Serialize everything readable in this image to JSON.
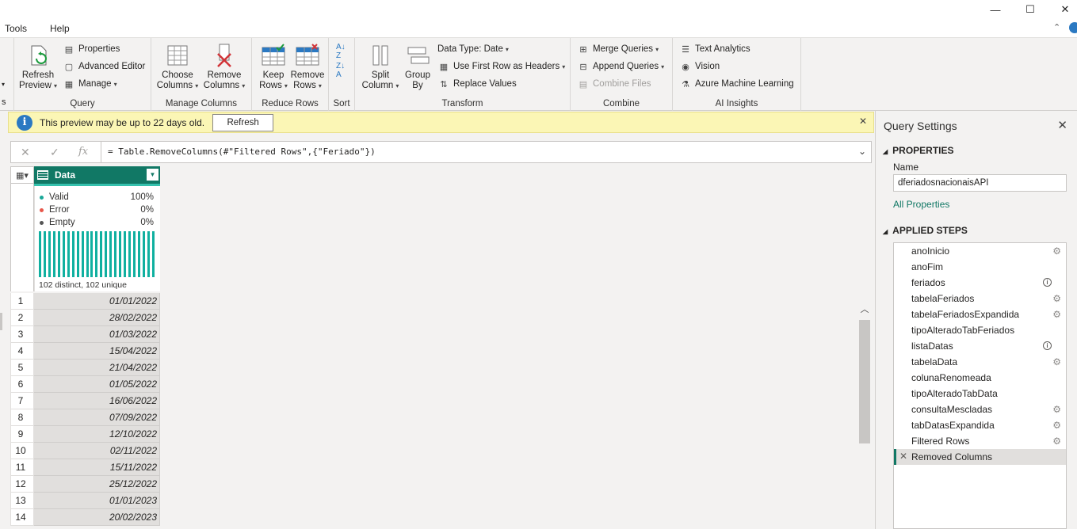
{
  "menu": {
    "tools": "Tools",
    "help": "Help"
  },
  "window_controls": {
    "minimize": "—",
    "maximize": "☐",
    "close": "✕"
  },
  "ribbon": {
    "query": {
      "label": "Query",
      "refresh_preview": [
        "Refresh",
        "Preview"
      ],
      "properties": "Properties",
      "advanced_editor": "Advanced Editor",
      "manage": "Manage"
    },
    "manage_columns": {
      "label": "Manage Columns",
      "choose": [
        "Choose",
        "Columns"
      ],
      "remove": [
        "Remove",
        "Columns"
      ]
    },
    "reduce_rows": {
      "label": "Reduce Rows",
      "keep": [
        "Keep",
        "Rows"
      ],
      "remove": [
        "Remove",
        "Rows"
      ]
    },
    "sort": {
      "label": "Sort"
    },
    "transform": {
      "label": "Transform",
      "split": [
        "Split",
        "Column"
      ],
      "group_by": [
        "Group",
        "By"
      ],
      "data_type": "Data Type: Date",
      "first_row_headers": "Use First Row as Headers",
      "replace_values": "Replace Values"
    },
    "combine": {
      "label": "Combine",
      "merge": "Merge Queries",
      "append": "Append Queries",
      "combine_files": "Combine Files"
    },
    "ai": {
      "label": "AI Insights",
      "text_analytics": "Text Analytics",
      "vision": "Vision",
      "azure_ml": "Azure Machine Learning"
    }
  },
  "banner": {
    "message": "This preview may be up to 22 days old.",
    "refresh": "Refresh"
  },
  "formula": "= Table.RemoveColumns(#\"Filtered Rows\",{\"Feriado\"})",
  "column": {
    "name": "Data",
    "quality": [
      {
        "label": "Valid",
        "pct": "100%",
        "color": "#1aa898"
      },
      {
        "label": "Error",
        "pct": "0%",
        "color": "#e8574a"
      },
      {
        "label": "Empty",
        "pct": "0%",
        "color": "#555555"
      }
    ],
    "distinct": "102 distinct, 102 unique"
  },
  "rows": [
    {
      "n": "1",
      "v": "01/01/2022"
    },
    {
      "n": "2",
      "v": "28/02/2022"
    },
    {
      "n": "3",
      "v": "01/03/2022"
    },
    {
      "n": "4",
      "v": "15/04/2022"
    },
    {
      "n": "5",
      "v": "21/04/2022"
    },
    {
      "n": "6",
      "v": "01/05/2022"
    },
    {
      "n": "7",
      "v": "16/06/2022"
    },
    {
      "n": "8",
      "v": "07/09/2022"
    },
    {
      "n": "9",
      "v": "12/10/2022"
    },
    {
      "n": "10",
      "v": "02/11/2022"
    },
    {
      "n": "11",
      "v": "15/11/2022"
    },
    {
      "n": "12",
      "v": "25/12/2022"
    },
    {
      "n": "13",
      "v": "01/01/2023"
    },
    {
      "n": "14",
      "v": "20/02/2023"
    }
  ],
  "query_settings": {
    "title": "Query Settings",
    "properties": "PROPERTIES",
    "name_label": "Name",
    "name_value": "dferiadosnacionaisAPI",
    "all_properties": "All Properties",
    "applied_steps": "APPLIED STEPS",
    "steps": [
      {
        "label": "anoInicio",
        "icon": "gear"
      },
      {
        "label": "anoFim",
        "icon": ""
      },
      {
        "label": "feriados",
        "icon": "info"
      },
      {
        "label": "tabelaFeriados",
        "icon": "gear"
      },
      {
        "label": "tabelaFeriadosExpandida",
        "icon": "gear"
      },
      {
        "label": "tipoAlteradoTabFeriados",
        "icon": ""
      },
      {
        "label": "listaDatas",
        "icon": "info"
      },
      {
        "label": "tabelaData",
        "icon": "gear"
      },
      {
        "label": "colunaRenomeada",
        "icon": ""
      },
      {
        "label": "tipoAlteradoTabData",
        "icon": ""
      },
      {
        "label": "consultaMescladas",
        "icon": "gear"
      },
      {
        "label": "tabDatasExpandida",
        "icon": "gear"
      },
      {
        "label": "Filtered Rows",
        "icon": "gear"
      },
      {
        "label": "Removed Columns",
        "icon": "",
        "active": true
      }
    ]
  }
}
